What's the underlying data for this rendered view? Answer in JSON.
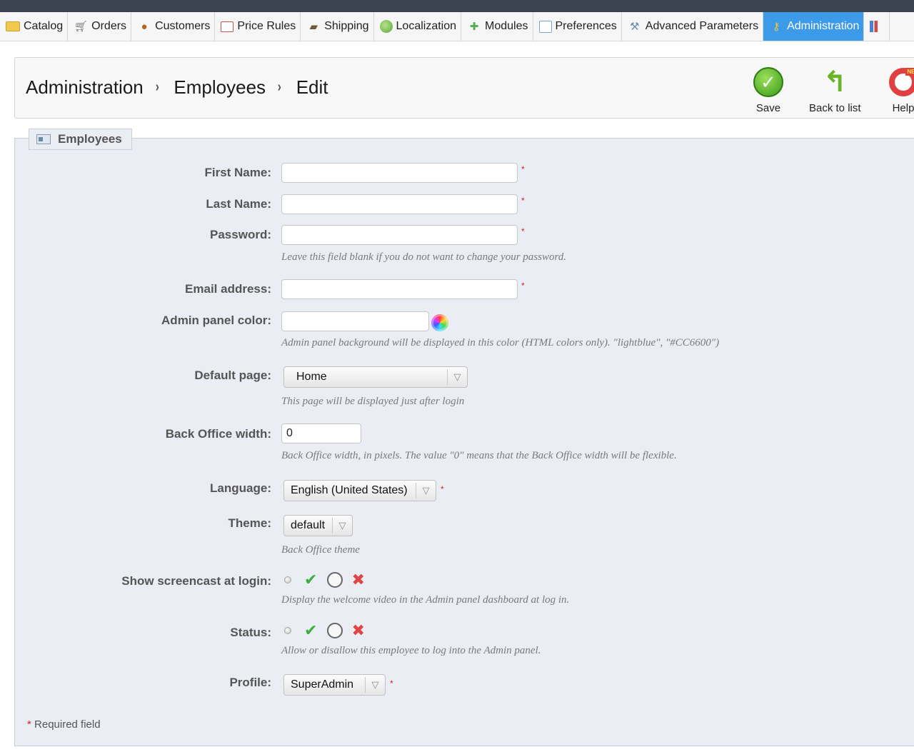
{
  "nav": {
    "tabs": [
      {
        "label": "Catalog",
        "icon": "folder-icon"
      },
      {
        "label": "Orders",
        "icon": "cart-icon"
      },
      {
        "label": "Customers",
        "icon": "user-icon"
      },
      {
        "label": "Price Rules",
        "icon": "price-tag-icon"
      },
      {
        "label": "Shipping",
        "icon": "truck-icon"
      },
      {
        "label": "Localization",
        "icon": "globe-icon"
      },
      {
        "label": "Modules",
        "icon": "puzzle-icon"
      },
      {
        "label": "Preferences",
        "icon": "pencil-icon"
      },
      {
        "label": "Advanced Parameters",
        "icon": "wrench-icon"
      },
      {
        "label": "Administration",
        "icon": "key-icon",
        "active": true
      }
    ]
  },
  "header": {
    "breadcrumb": [
      "Administration",
      "Employees",
      "Edit"
    ],
    "separator": "›",
    "toolbar": {
      "save_label": "Save",
      "back_label": "Back to list",
      "help_label": "Help",
      "help_badge": "NEW"
    }
  },
  "form": {
    "legend": "Employees",
    "fields": {
      "first_name_label": "First Name:",
      "last_name_label": "Last Name:",
      "password_label": "Password:",
      "password_hint": "Leave this field blank if you do not want to change your password.",
      "email_label": "Email address:",
      "admin_color_label": "Admin panel color:",
      "admin_color_hint": "Admin panel background will be displayed in this color (HTML colors only). \"lightblue\", \"#CC6600\")",
      "default_page_label": "Default page:",
      "default_page_value": "Home",
      "default_page_hint": "This page will be displayed just after login",
      "bo_width_label": "Back Office width:",
      "bo_width_value": "0",
      "bo_width_hint": "Back Office width, in pixels. The value \"0\" means that the Back Office width will be flexible.",
      "language_label": "Language:",
      "language_value": "English (United States)",
      "theme_label": "Theme:",
      "theme_value": "default",
      "theme_hint": "Back Office theme",
      "screencast_label": "Show screencast at login:",
      "screencast_hint": "Display the welcome video in the Admin panel dashboard at log in.",
      "status_label": "Status:",
      "status_hint": "Allow or disallow this employee to log into the Admin panel.",
      "profile_label": "Profile:",
      "profile_value": "SuperAdmin"
    },
    "required_mark": "*",
    "required_note": "Required field"
  },
  "colors": {
    "active_tab": "#3d9ae8",
    "form_bg": "#ebedf4",
    "required": "#d42020"
  }
}
